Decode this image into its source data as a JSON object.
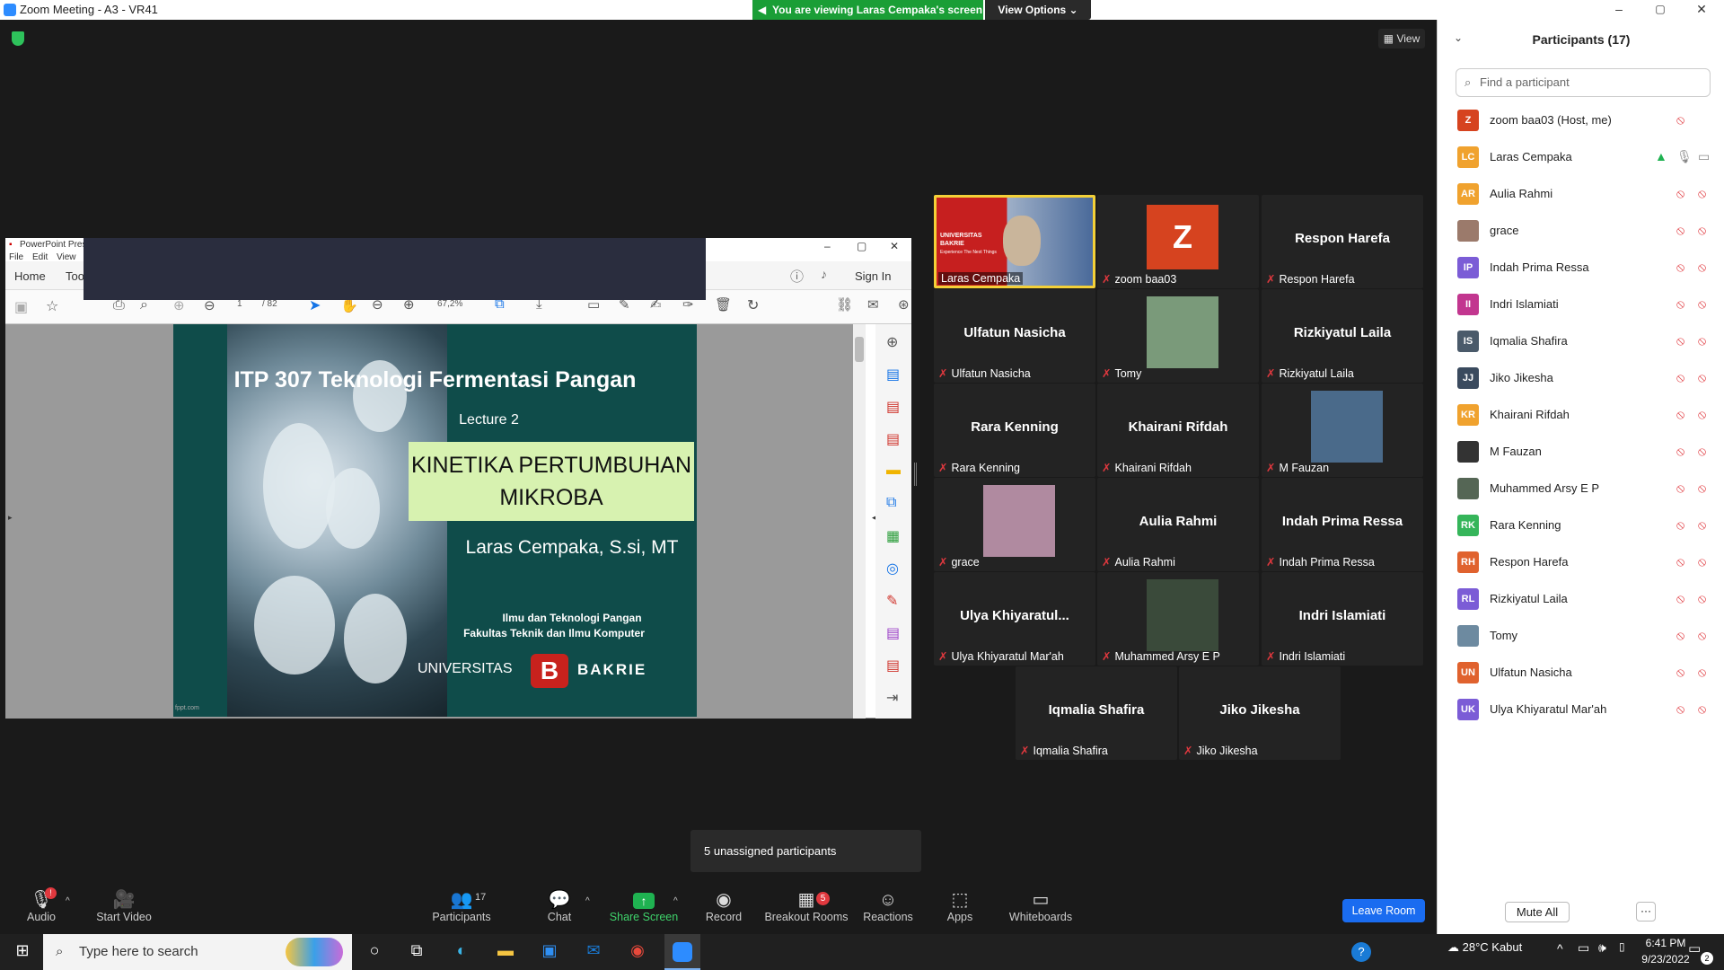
{
  "window": {
    "title": "Zoom Meeting - A3 - VR41",
    "minimize": "–",
    "maximize": "▢",
    "close": "✕"
  },
  "banner": {
    "text": "You are viewing Laras Cempaka's screen",
    "options": "View Options ⌄"
  },
  "view_button": "View",
  "shared": {
    "app_title": "PowerPoint Prese",
    "menu": [
      "File",
      "Edit",
      "View"
    ],
    "nav_home": "Home",
    "nav_tools": "Too",
    "sign_in": "Sign In",
    "page_current": "1",
    "page_total": "/ 82",
    "zoom": "67,2%",
    "slide": {
      "title": "ITP 307 Teknologi Fermentasi Pangan",
      "lecture": "Lecture 2",
      "topic_line1": "KINETIKA PERTUMBUHAN",
      "topic_line2": "MIKROBA",
      "author": "Laras Cempaka, S.si, MT",
      "dept1": "Ilmu dan Teknologi Pangan",
      "dept2": "Fakultas Teknik dan Ilmu Komputer",
      "univ_left": "UNIVERSITAS",
      "univ_right": "BAKRIE",
      "footer": "fppt.com"
    }
  },
  "tiles": [
    {
      "name": "",
      "label": "Laras Cempaka"
    },
    {
      "name": "Z",
      "label": "zoom baa03"
    },
    {
      "name": "Respon Harefa",
      "label": "Respon Harefa"
    },
    {
      "name": "Ulfatun Nasicha",
      "label": "Ulfatun Nasicha"
    },
    {
      "name": "",
      "label": "Tomy"
    },
    {
      "name": "Rizkiyatul Laila",
      "label": "Rizkiyatul Laila"
    },
    {
      "name": "Rara Kenning",
      "label": "Rara Kenning"
    },
    {
      "name": "Khairani Rifdah",
      "label": "Khairani Rifdah"
    },
    {
      "name": "",
      "label": "M Fauzan"
    },
    {
      "name": "",
      "label": "grace"
    },
    {
      "name": "Aulia Rahmi",
      "label": "Aulia Rahmi"
    },
    {
      "name": "Indah Prima Ressa",
      "label": "Indah Prima Ressa"
    },
    {
      "name": "Ulya  Khiyaratul...",
      "label": "Ulya Khiyaratul Mar'ah"
    },
    {
      "name": "",
      "label": "Muhammed Arsy E P"
    },
    {
      "name": "Indri Islamiati",
      "label": "Indri Islamiati"
    },
    {
      "name": "Iqmalia Shafira",
      "label": "Iqmalia Shafira"
    },
    {
      "name": "Jiko Jikesha",
      "label": "Jiko Jikesha"
    }
  ],
  "laras_tile": {
    "u1": "UNIVERSITAS",
    "u2": "BAKRIE",
    "tag": "Experience The Next Things"
  },
  "unassigned": "5 unassigned participants",
  "toolbar": {
    "audio": "Audio",
    "start_video": "Start Video",
    "participants": "Participants",
    "participants_count": "17",
    "chat": "Chat",
    "share_screen": "Share Screen",
    "record": "Record",
    "breakout": "Breakout Rooms",
    "breakout_badge": "5",
    "reactions": "Reactions",
    "apps": "Apps",
    "whiteboards": "Whiteboards",
    "leave": "Leave Room",
    "audio_badge": "!"
  },
  "panel": {
    "title": "Participants (17)",
    "search_placeholder": "Find a participant",
    "mute_all": "Mute All",
    "more": "···",
    "participants": [
      {
        "initials": "Z",
        "name": "zoom baa03 (Host, me)",
        "color": "#d6431f"
      },
      {
        "initials": "LC",
        "name": "Laras Cempaka",
        "color": "#f0a22e"
      },
      {
        "initials": "AR",
        "name": "Aulia Rahmi",
        "color": "#f0a22e"
      },
      {
        "initials": "",
        "name": "grace",
        "color": "#9b7a6b"
      },
      {
        "initials": "IP",
        "name": "Indah Prima Ressa",
        "color": "#7b5cd6"
      },
      {
        "initials": "II",
        "name": "Indri Islamiati",
        "color": "#c2368f"
      },
      {
        "initials": "IS",
        "name": "Iqmalia Shafira",
        "color": "#4a5a6a"
      },
      {
        "initials": "JJ",
        "name": "Jiko Jikesha",
        "color": "#3a4a5e"
      },
      {
        "initials": "KR",
        "name": "Khairani Rifdah",
        "color": "#f0a22e"
      },
      {
        "initials": "",
        "name": "M Fauzan",
        "color": "#333333"
      },
      {
        "initials": "",
        "name": "Muhammed Arsy E P",
        "color": "#556655"
      },
      {
        "initials": "RK",
        "name": "Rara Kenning",
        "color": "#35b55a"
      },
      {
        "initials": "RH",
        "name": "Respon Harefa",
        "color": "#e0622e"
      },
      {
        "initials": "RL",
        "name": "Rizkiyatul Laila",
        "color": "#7b5cd6"
      },
      {
        "initials": "",
        "name": "Tomy",
        "color": "#6d8aa0"
      },
      {
        "initials": "UN",
        "name": "Ulfatun Nasicha",
        "color": "#e0622e"
      },
      {
        "initials": "UK",
        "name": "Ulya Khiyaratul Mar'ah",
        "color": "#7b5cd6"
      }
    ]
  },
  "taskbar": {
    "search": "Type here to search",
    "weather": "28°C  Kabut",
    "time": "6:41 PM",
    "date": "9/23/2022",
    "notif": "2"
  }
}
